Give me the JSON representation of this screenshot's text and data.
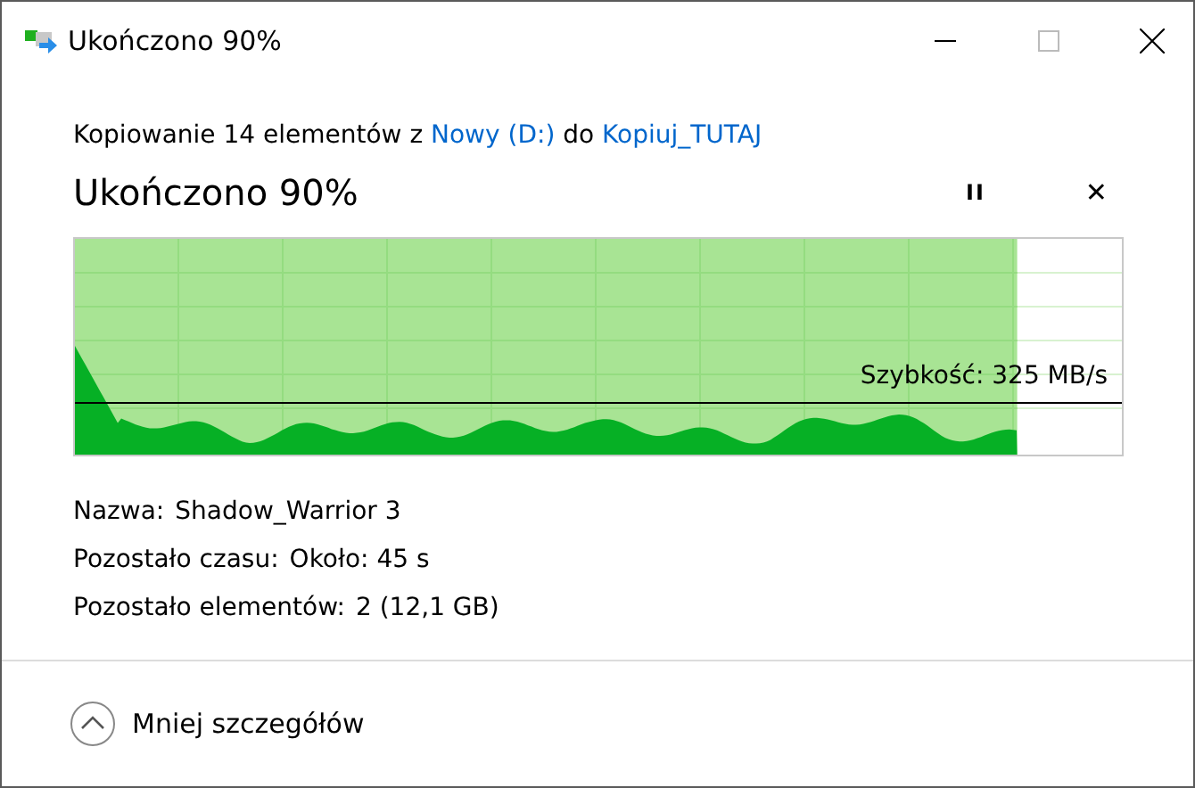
{
  "window": {
    "title": "Ukończono 90%"
  },
  "summary": [
    {
      "kind": "text",
      "text": "Kopiowanie 14 elementów z "
    },
    {
      "kind": "link",
      "text": "Nowy (D:)"
    },
    {
      "kind": "text",
      "text": " do "
    },
    {
      "kind": "link",
      "text": "Kopiuj_TUTAJ"
    }
  ],
  "heading": "Ukończono 90%",
  "pause_button": "II",
  "cancel_button": "✕",
  "progress": {
    "level": 0.9,
    "speed": "Szybkość: 325 MB/s"
  },
  "details": [
    {
      "label": "Nazwa:",
      "value": "Shadow_Warrior 3"
    },
    {
      "label": "Pozostało czasu:",
      "value": "Około: 45 s"
    },
    {
      "label": "Pozostało elementów:",
      "value": "2 (12,1 GB)"
    }
  ],
  "toggle": {
    "label": "Mniej szczegółów",
    "expanded": true
  }
}
